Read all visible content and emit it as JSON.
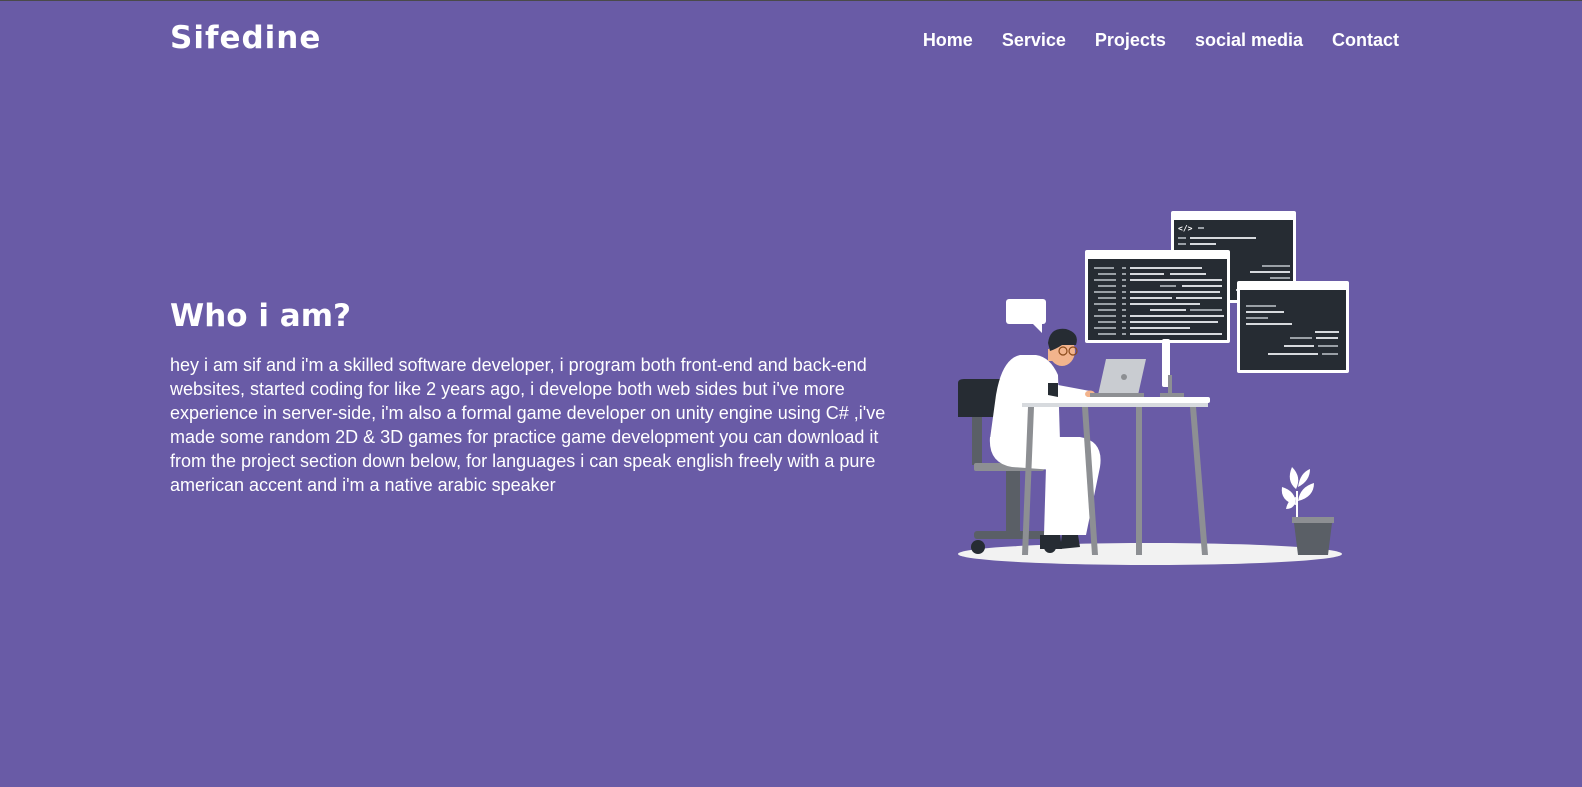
{
  "header": {
    "logo": "Sifedine",
    "nav": [
      {
        "label": "Home"
      },
      {
        "label": "Service"
      },
      {
        "label": "Projects"
      },
      {
        "label": "social media"
      },
      {
        "label": "Contact"
      }
    ]
  },
  "hero": {
    "title": "Who i am?",
    "description": "hey i am sif and i'm a skilled software developer, i program both front-end and back-end websites, started coding for like 2 years ago, i develope both web sides but i've more experience in server-side, i'm also a formal game developer on unity engine using C# ,i've made some random 2D & 3D games for practice game development you can download it from the project section down below, for languages i can speak english freely with a pure american accent and i'm a native arabic speaker",
    "illustration": {
      "code_tag": "</>"
    }
  },
  "colors": {
    "background": "#695ba6",
    "text": "#ffffff",
    "screen_dark": "#262c33",
    "desk_gray": "#8d8f93"
  }
}
